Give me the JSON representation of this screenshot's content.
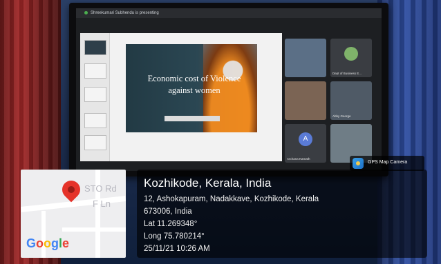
{
  "meeting": {
    "presenting_text": "Shreekumari Subhendu is presenting",
    "slide_title": "Economic cost of Violence against women",
    "participants": [
      {
        "label": ""
      },
      {
        "label": "Dept of Business E..."
      },
      {
        "label": ""
      },
      {
        "label": "Abby George"
      },
      {
        "label": "Archana Kamath"
      },
      {
        "label": ""
      }
    ]
  },
  "gps_camera": {
    "app_name": "GPS Map Camera",
    "place": "Kozhikode, Kerala, India",
    "address_line1": "12, Ashokapuram, Nadakkave, Kozhikode, Kerala",
    "address_line2": "673006, India",
    "lat": "Lat 11.269348°",
    "long": "Long 75.780214°",
    "datetime": "25/11/21 10:26 AM"
  },
  "map": {
    "street1": "STO Rd",
    "street2": "F Ln",
    "logo_text": "Google",
    "pin_icon": "location-pin-icon",
    "pin_color": "#e5332a"
  }
}
